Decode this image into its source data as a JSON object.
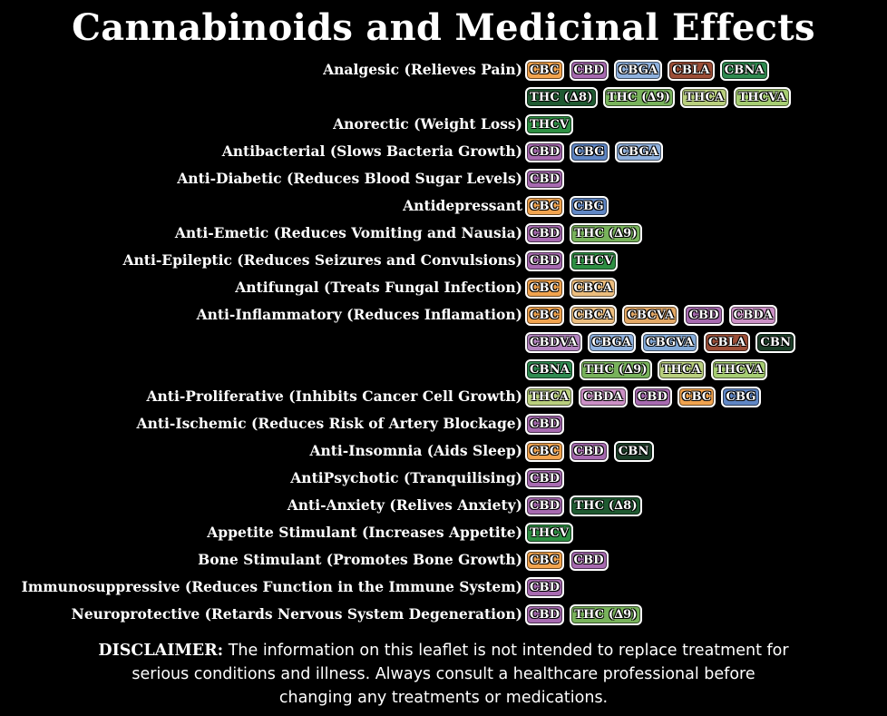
{
  "title": "Cannabinoids and Medicinal Effects",
  "colors": {
    "CBC": "#f1a34e",
    "CBD": "#a76ab0",
    "CBG": "#5f86c4",
    "CBGA": "#8fb1de",
    "CBLA": "#9c4e37",
    "CBNA": "#2f8a50",
    "CBN": "#1b3d27",
    "THC (∆8)": "#1f5a31",
    "THC (∆9)": "#78b25b",
    "THCA": "#b9cf7d",
    "THCVA": "#a6cd72",
    "THCV": "#2e8f43",
    "CBCA": "#ecbd7d",
    "CBCVA": "#e3a865",
    "CBDA": "#cc90c6",
    "CBDVA": "#b384c0",
    "CBGVA": "#83aad8"
  },
  "rows": [
    {
      "effect": "Analgesic (Relieves Pain)",
      "badges": [
        "CBC",
        "CBD",
        "CBGA",
        "CBLA",
        "CBNA"
      ]
    },
    {
      "effect": "",
      "badges": [
        "THC (∆8)",
        "THC (∆9)",
        "THCA",
        "THCVA"
      ]
    },
    {
      "effect": "Anorectic (Weight Loss)",
      "badges": [
        "THCV"
      ]
    },
    {
      "effect": "Antibacterial (Slows Bacteria Growth)",
      "badges": [
        "CBD",
        "CBG",
        "CBGA"
      ]
    },
    {
      "effect": "Anti-Diabetic (Reduces Blood Sugar Levels)",
      "badges": [
        "CBD"
      ]
    },
    {
      "effect": "Antidepressant",
      "badges": [
        "CBC",
        "CBG"
      ]
    },
    {
      "effect": "Anti-Emetic (Reduces Vomiting and Nausia)",
      "badges": [
        "CBD",
        "THC (∆9)"
      ]
    },
    {
      "effect": "Anti-Epileptic (Reduces Seizures and Convulsions)",
      "badges": [
        "CBD",
        "THCV"
      ]
    },
    {
      "effect": "Antifungal (Treats Fungal Infection)",
      "badges": [
        "CBC",
        "CBCA"
      ]
    },
    {
      "effect": "Anti-Inflammatory (Reduces Inflamation)",
      "badges": [
        "CBC",
        "CBCA",
        "CBCVA",
        "CBD",
        "CBDA"
      ]
    },
    {
      "effect": "",
      "badges": [
        "CBDVA",
        "CBGA",
        "CBGVA",
        "CBLA",
        "CBN"
      ]
    },
    {
      "effect": "",
      "badges": [
        "CBNA",
        "THC (∆9)",
        "THCA",
        "THCVA"
      ]
    },
    {
      "effect": "Anti-Proliferative (Inhibits Cancer Cell Growth)",
      "badges": [
        "THCA",
        "CBDA",
        "CBD",
        "CBC",
        "CBG"
      ]
    },
    {
      "effect": "Anti-Ischemic (Reduces Risk of Artery Blockage)",
      "badges": [
        "CBD"
      ]
    },
    {
      "effect": "Anti-Insomnia (Aids Sleep)",
      "badges": [
        "CBC",
        "CBD",
        "CBN"
      ]
    },
    {
      "effect": "AntiPsychotic (Tranquilising)",
      "badges": [
        "CBD"
      ]
    },
    {
      "effect": "Anti-Anxiety (Relives Anxiety)",
      "badges": [
        "CBD",
        "THC (∆8)"
      ]
    },
    {
      "effect": "Appetite Stimulant (Increases Appetite)",
      "badges": [
        "THCV"
      ]
    },
    {
      "effect": "Bone Stimulant (Promotes Bone Growth)",
      "badges": [
        "CBC",
        "CBD"
      ]
    },
    {
      "effect": "Immunosuppressive (Reduces Function in the Immune System)",
      "badges": [
        "CBD"
      ]
    },
    {
      "effect": "Neuroprotective (Retards Nervous System Degeneration)",
      "badges": [
        "CBD",
        "THC (∆9)"
      ]
    }
  ],
  "disclaimer": {
    "lead": "DISCLAIMER:",
    "line1": " The information on this leaflet is not intended to replace treatment for",
    "line2": "serious conditions and illness. Always consult a healthcare professional before",
    "line3": "changing any treatments or medications."
  }
}
